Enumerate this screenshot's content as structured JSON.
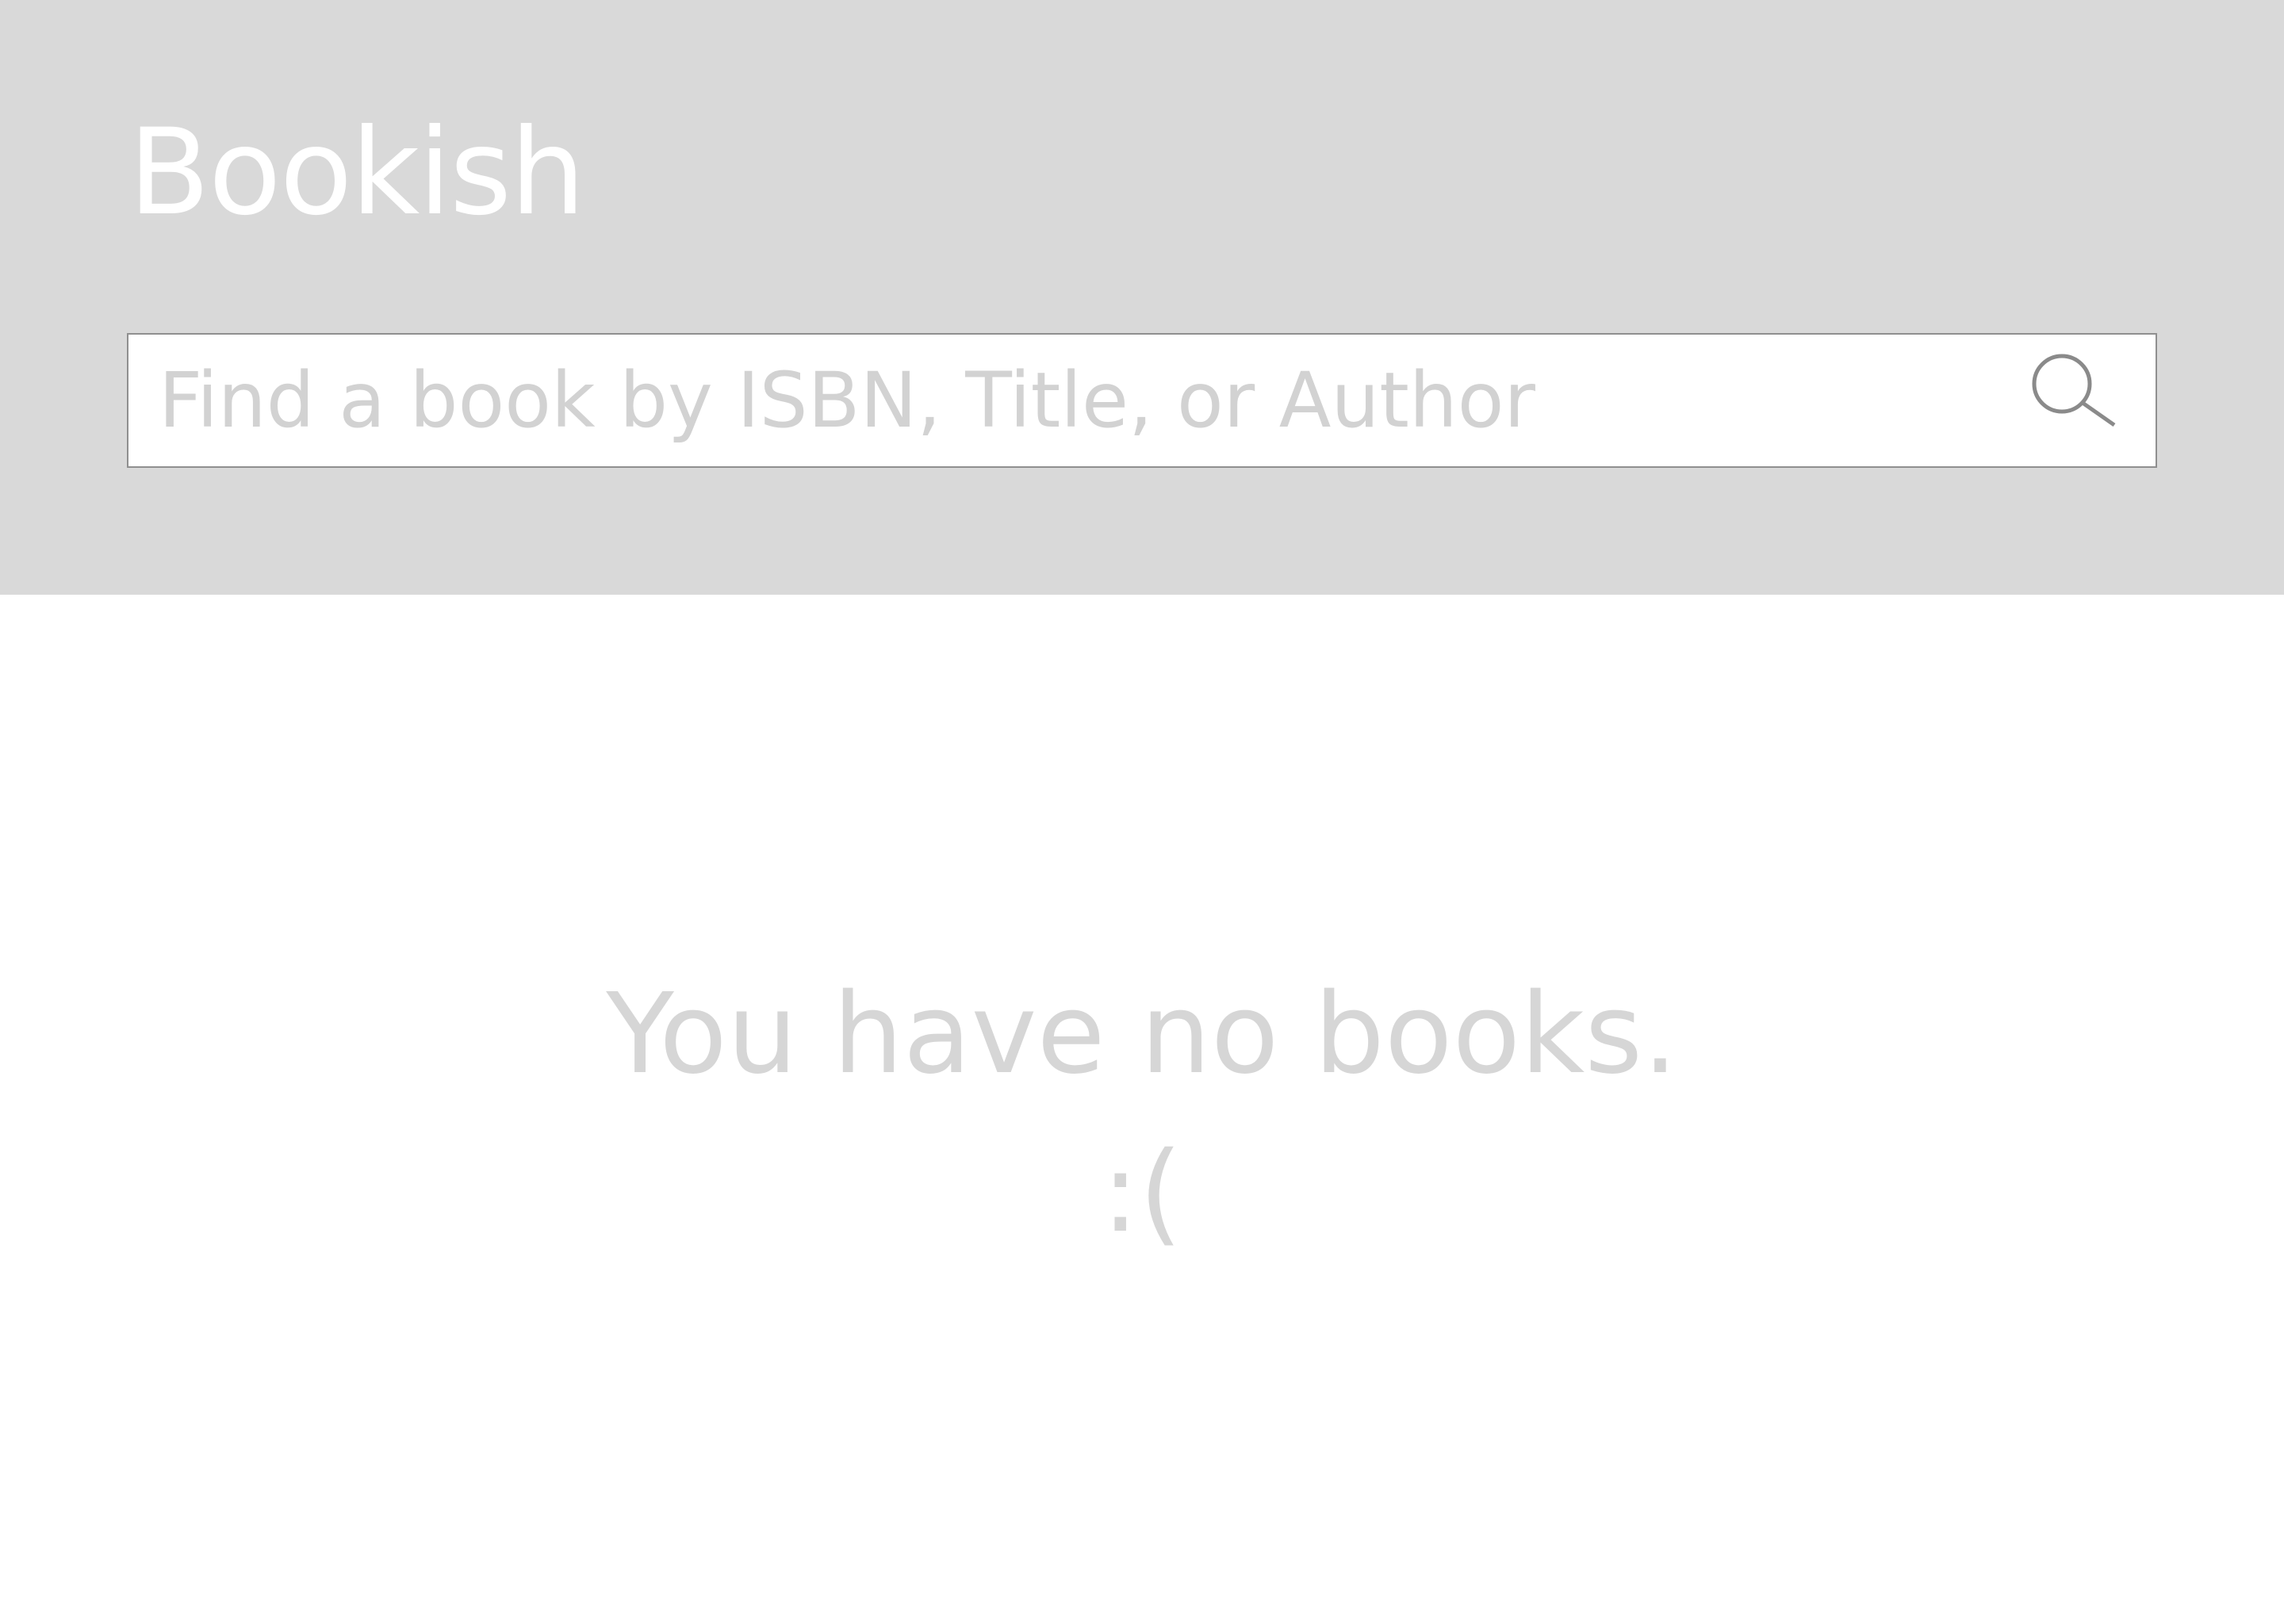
{
  "header": {
    "title": "Bookish",
    "background_color": "#d9d9d9",
    "title_color": "#ffffff"
  },
  "search": {
    "placeholder": "Find a book by ISBN, Title, or Author",
    "value": "",
    "icon": "search-icon",
    "border_color": "#8f8f8f",
    "icon_color": "#8a8a8a"
  },
  "empty_state": {
    "message": "You have no books.",
    "emoticon": ":(",
    "text_color": "#d6d6d6"
  }
}
